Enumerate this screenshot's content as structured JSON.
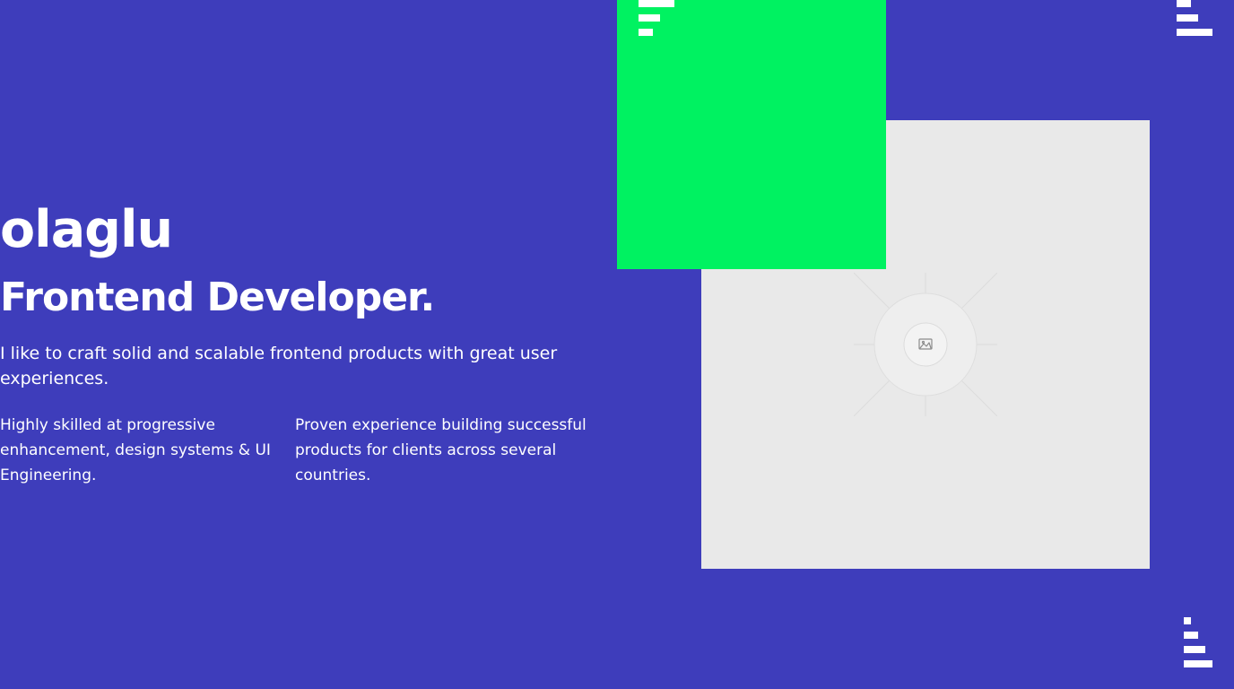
{
  "hero": {
    "name": "olaglu",
    "role": "Frontend Developer.",
    "intro": "I like to craft solid and scalable frontend products with great user experiences.",
    "features": [
      "Highly skilled at progressive enhancement, design systems & UI Engineering.",
      "Proven experience building successful products for clients across several countries."
    ]
  },
  "colors": {
    "background": "#3e3dbb",
    "accent": "#00f261",
    "placeholder": "#e9e9e9",
    "text": "#ffffff"
  },
  "icons": {
    "placeholder": "image-placeholder-icon",
    "decor": "bars-decoration-icon"
  }
}
